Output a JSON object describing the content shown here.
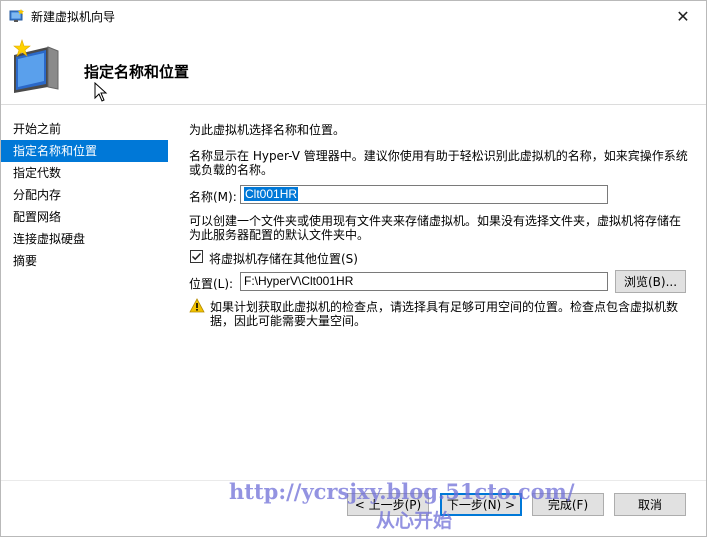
{
  "window": {
    "title": "新建虚拟机向导",
    "close_glyph": "✕"
  },
  "header": {
    "page_title": "指定名称和位置"
  },
  "sidebar": {
    "items": [
      {
        "label": "开始之前"
      },
      {
        "label": "指定名称和位置",
        "selected": true
      },
      {
        "label": "指定代数"
      },
      {
        "label": "分配内存"
      },
      {
        "label": "配置网络"
      },
      {
        "label": "连接虚拟硬盘"
      },
      {
        "label": "摘要"
      }
    ]
  },
  "content": {
    "intro": "为此虚拟机选择名称和位置。",
    "name_desc_line1": "名称显示在 Hyper-V 管理器中。建议你使用有助于轻松识别此虚拟机的名称，如来宾操作系统",
    "name_desc_line2": "或负载的名称。",
    "name_label": "名称(M):",
    "name_value": "Clt001HR",
    "folder_desc_line1": "可以创建一个文件夹或使用现有文件夹来存储虚拟机。如果没有选择文件夹，虚拟机将存储在",
    "folder_desc_line2": "为此服务器配置的默认文件夹中。",
    "store_elsewhere_label": "将虚拟机存储在其他位置(S)",
    "store_elsewhere_checked": true,
    "location_label": "位置(L):",
    "location_value": "F:\\HyperV\\Clt001HR",
    "browse_label": "浏览(B)...",
    "warning_line1": "如果计划获取此虚拟机的检查点，请选择具有足够可用空间的位置。检查点包含虚拟机数",
    "warning_line2": "据，因此可能需要大量空间。"
  },
  "footer": {
    "prev_label": "< 上一步(P)",
    "next_label": "下一步(N) >",
    "finish_label": "完成(F)",
    "cancel_label": "取消"
  },
  "watermark": {
    "url": "http://ycrsjxy.blog.51cto.com/",
    "text": "从心开始"
  },
  "colors": {
    "accent": "#0078d7",
    "button_face": "#e1e1e1",
    "warning": "#f2c200"
  }
}
